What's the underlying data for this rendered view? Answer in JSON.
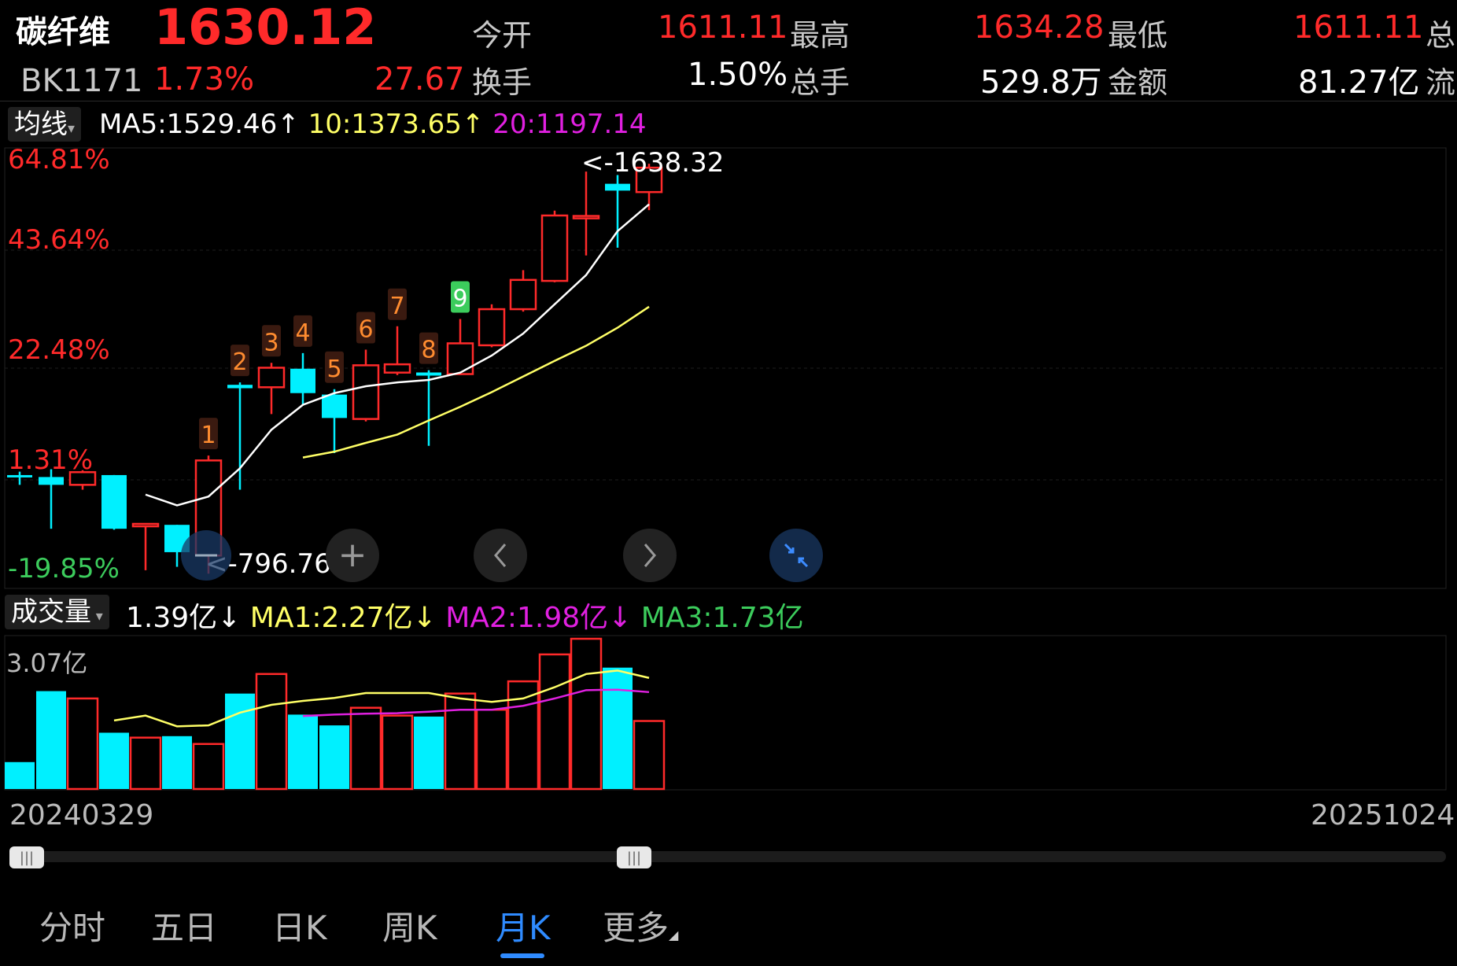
{
  "header": {
    "name": "碳纤维",
    "price": "1630.12",
    "code": "BK1171",
    "change_pct": "1.73%",
    "change_abs": "27.67",
    "stats": [
      {
        "label": "今开",
        "value": "1611.11",
        "color": "#ff2a2a"
      },
      {
        "label": "最高",
        "value": "1634.28",
        "color": "#ff2a2a"
      },
      {
        "label": "最低",
        "value": "1611.11",
        "color": "#ff2a2a"
      },
      {
        "label": "总",
        "value": "",
        "color": "#ff2a2a"
      },
      {
        "label": "换手",
        "value": "1.50%",
        "color": "#ffffff"
      },
      {
        "label": "总手",
        "value": "529.8万",
        "color": "#ffffff"
      },
      {
        "label": "金额",
        "value": "81.27亿",
        "color": "#ffffff"
      },
      {
        "label": "流",
        "value": "",
        "color": "#ffffff"
      }
    ]
  },
  "indicator": {
    "selector": "均线",
    "ma5": "MA5:1529.46↑",
    "ma10": "10:1373.65↑",
    "ma20": "20:1197.14"
  },
  "volume_indicator": {
    "selector": "成交量",
    "vol": "1.39亿↓",
    "ma1": "MA1:2.27亿↓",
    "ma2": "MA2:1.98亿↓",
    "ma3": "MA3:1.73亿"
  },
  "colors": {
    "up": "#ff2a2a",
    "down": "#00f0ff",
    "ma5": "#ffffff",
    "ma10": "#ffff66",
    "ma20": "#e020e0",
    "ma3": "#3ccc5c",
    "accent": "#2f8bff"
  },
  "controls": {
    "zoom_in": "+",
    "prev": "‹",
    "next": "›",
    "collapse_icon": "collapse-arrows-icon"
  },
  "axis": {
    "start_date": "20240329",
    "end_date": "20251024",
    "vol_max_label": "3.07亿"
  },
  "tabs": [
    {
      "label": "分时",
      "active": false
    },
    {
      "label": "五日",
      "active": false
    },
    {
      "label": "日K",
      "active": false
    },
    {
      "label": "周K",
      "active": false
    },
    {
      "label": "月K",
      "active": true
    },
    {
      "label": "更多",
      "active": false
    }
  ],
  "chart_data": {
    "type": "candlestick",
    "y_axis_labels": [
      "64.81%",
      "43.64%",
      "22.48%",
      "1.31%",
      "-19.85%"
    ],
    "y_range": [
      796.76,
      1638.32
    ],
    "high_label": "<-1638.32",
    "low_label": "<-796.76",
    "candles": [
      {
        "o": 1000,
        "h": 1007,
        "l": 980,
        "c": 1000,
        "dir": "down"
      },
      {
        "o": 996,
        "h": 1012,
        "l": 890,
        "c": 980,
        "dir": "down"
      },
      {
        "o": 980,
        "h": 1010,
        "l": 970,
        "c": 1006,
        "dir": "up"
      },
      {
        "o": 1000,
        "h": 1000,
        "l": 888,
        "c": 890,
        "dir": "down"
      },
      {
        "o": 895,
        "h": 900,
        "l": 805,
        "c": 900,
        "dir": "up"
      },
      {
        "o": 898,
        "h": 898,
        "l": 812,
        "c": 842,
        "dir": "down"
      },
      {
        "o": 835,
        "h": 1040,
        "l": 798,
        "c": 1030,
        "dir": "up"
      },
      {
        "o": 1185,
        "h": 1190,
        "l": 970,
        "c": 1178,
        "dir": "down"
      },
      {
        "o": 1180,
        "h": 1230,
        "l": 1125,
        "c": 1220,
        "dir": "up"
      },
      {
        "o": 1218,
        "h": 1250,
        "l": 1145,
        "c": 1168,
        "dir": "down"
      },
      {
        "o": 1165,
        "h": 1176,
        "l": 1045,
        "c": 1117,
        "dir": "down"
      },
      {
        "o": 1115,
        "h": 1257,
        "l": 1110,
        "c": 1225,
        "dir": "up"
      },
      {
        "o": 1210,
        "h": 1305,
        "l": 1205,
        "c": 1227,
        "dir": "up"
      },
      {
        "o": 1207,
        "h": 1215,
        "l": 1060,
        "c": 1205,
        "dir": "doji"
      },
      {
        "o": 1207,
        "h": 1320,
        "l": 1205,
        "c": 1270,
        "dir": "up"
      },
      {
        "o": 1266,
        "h": 1350,
        "l": 1262,
        "c": 1340,
        "dir": "up"
      },
      {
        "o": 1340,
        "h": 1420,
        "l": 1335,
        "c": 1400,
        "dir": "up"
      },
      {
        "o": 1398,
        "h": 1542,
        "l": 1395,
        "c": 1532,
        "dir": "up"
      },
      {
        "o": 1530,
        "h": 1622,
        "l": 1450,
        "c": 1531,
        "dir": "up"
      },
      {
        "o": 1597,
        "h": 1615,
        "l": 1466,
        "c": 1583,
        "dir": "down"
      },
      {
        "o": 1580,
        "h": 1638,
        "l": 1543,
        "c": 1630,
        "dir": "up"
      }
    ],
    "td_labels": [
      {
        "i": 6,
        "text": "1",
        "color": "#ff8c30"
      },
      {
        "i": 7,
        "text": "2",
        "color": "#ff8c30"
      },
      {
        "i": 8,
        "text": "3",
        "color": "#ff8c30"
      },
      {
        "i": 9,
        "text": "4",
        "color": "#ff8c30"
      },
      {
        "i": 10,
        "text": "5",
        "color": "#ff8c30"
      },
      {
        "i": 11,
        "text": "6",
        "color": "#ff8c30"
      },
      {
        "i": 12,
        "text": "7",
        "color": "#ff8c30"
      },
      {
        "i": 13,
        "text": "8",
        "color": "#ff8c30"
      },
      {
        "i": 14,
        "text": "9",
        "color": "#3ccc5c"
      }
    ],
    "ma5": [
      null,
      null,
      null,
      null,
      960,
      938,
      956,
      1014,
      1093,
      1144,
      1168,
      1182,
      1190,
      1195,
      1210,
      1245,
      1290,
      1350,
      1410,
      1500,
      1555
    ],
    "ma10": [
      null,
      null,
      null,
      null,
      null,
      null,
      null,
      null,
      null,
      1036,
      1048,
      1066,
      1083,
      1112,
      1140,
      1170,
      1202,
      1234,
      1265,
      1302,
      1345
    ],
    "volume": [
      0.55,
      2.0,
      1.85,
      1.15,
      1.05,
      1.08,
      0.92,
      1.95,
      2.35,
      1.52,
      1.3,
      1.66,
      1.5,
      1.48,
      1.95,
      1.62,
      2.2,
      2.75,
      3.07,
      2.48,
      1.39
    ],
    "vol_ma1": [
      null,
      null,
      null,
      1.4,
      1.5,
      1.28,
      1.3,
      1.56,
      1.72,
      1.8,
      1.86,
      1.96,
      1.96,
      1.96,
      1.85,
      1.78,
      1.85,
      2.08,
      2.35,
      2.42,
      2.27
    ],
    "vol_ma2": [
      null,
      null,
      null,
      null,
      null,
      null,
      null,
      null,
      null,
      1.49,
      1.52,
      1.54,
      1.55,
      1.58,
      1.62,
      1.62,
      1.7,
      1.85,
      2.02,
      2.03,
      1.98
    ],
    "vol_ymax": 3.07
  }
}
